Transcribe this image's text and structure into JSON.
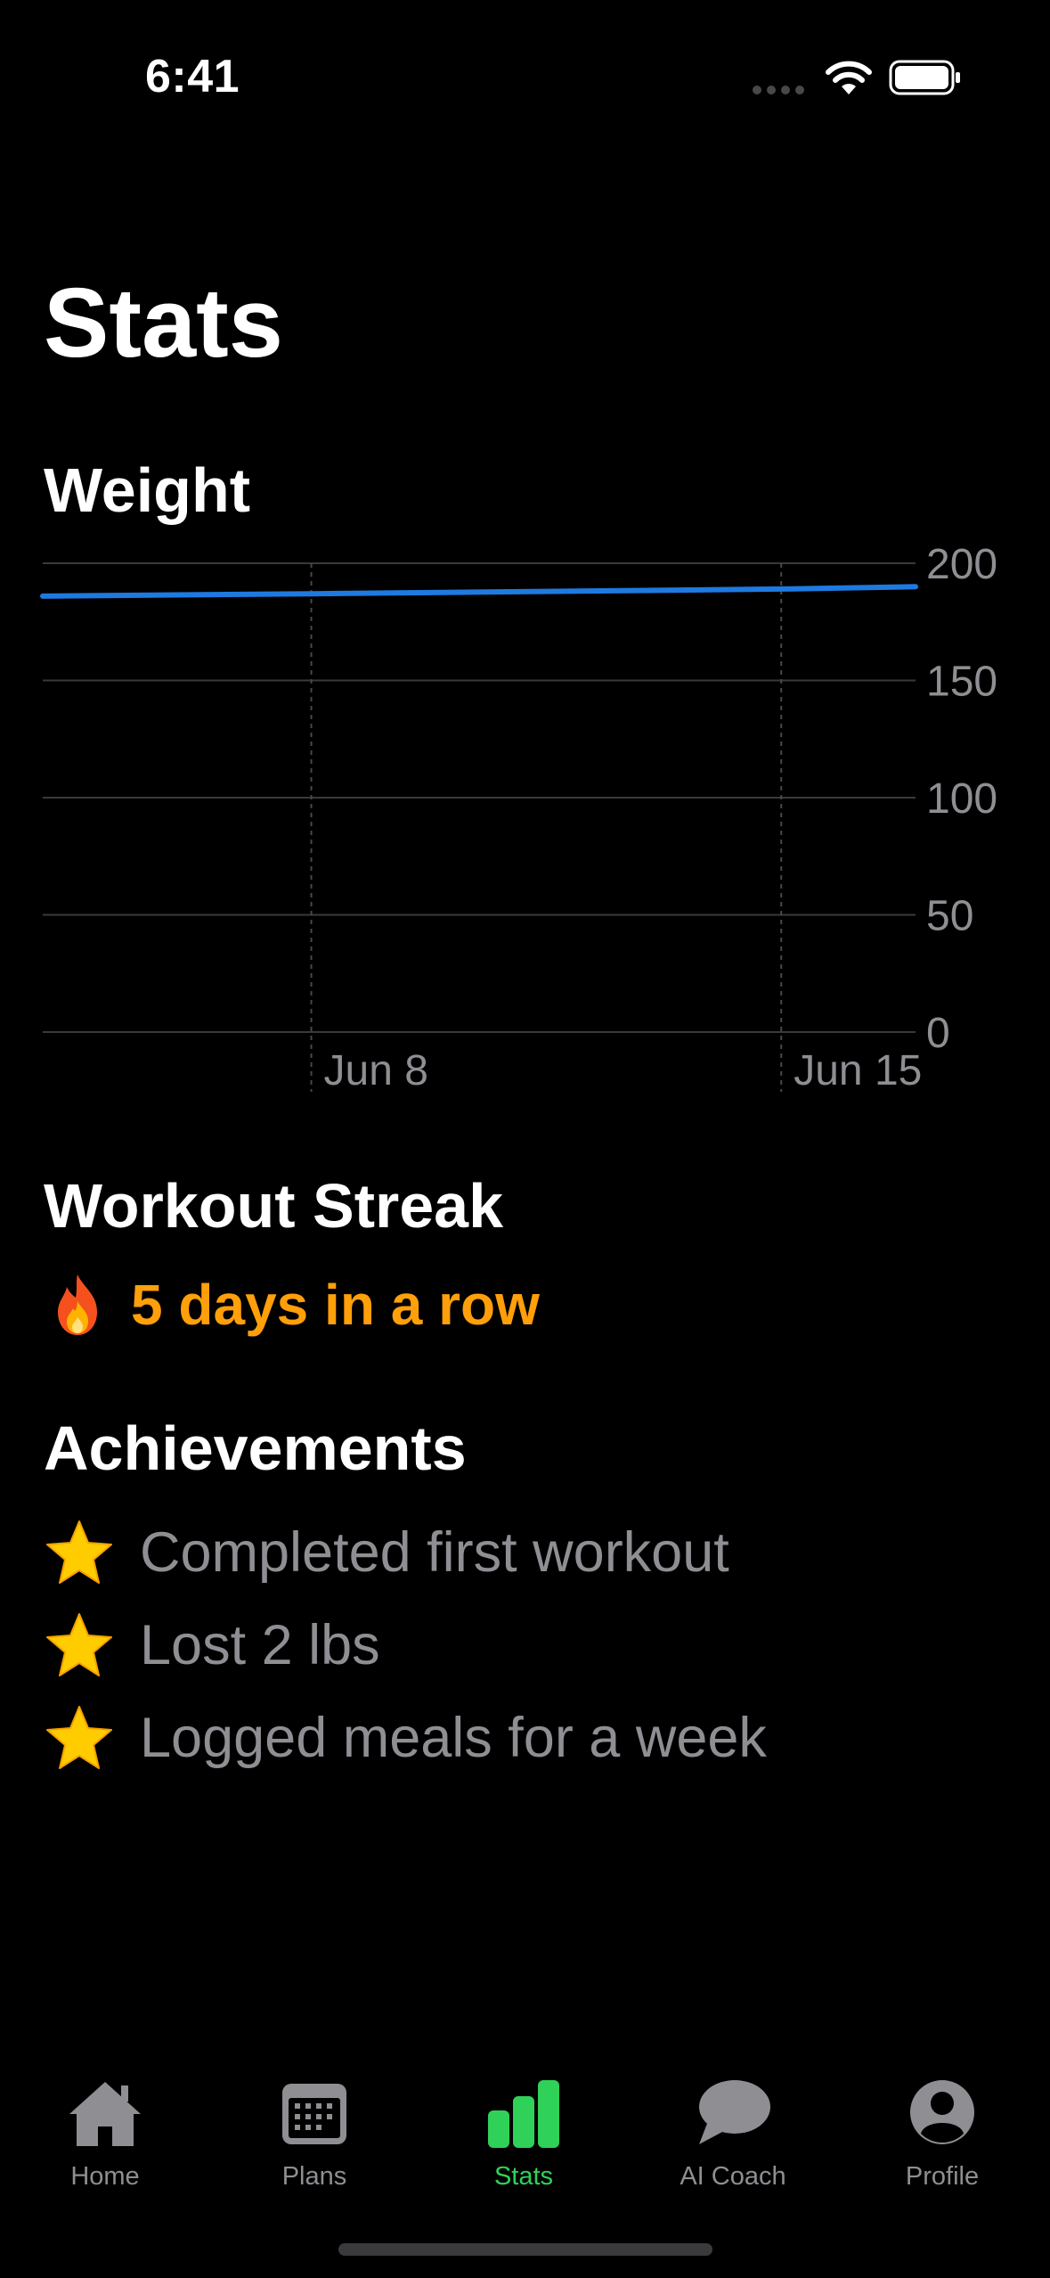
{
  "status_bar": {
    "time": "6:41"
  },
  "page_title": "Stats",
  "weight": {
    "title": "Weight",
    "chart_data": {
      "type": "line",
      "series": [
        {
          "x": [
            "Jun 4",
            "Jun 8",
            "Jun 15",
            "Jun 17"
          ],
          "values": [
            186,
            187,
            189,
            190
          ]
        }
      ],
      "x_ticks": [
        "Jun 8",
        "Jun 15"
      ],
      "y_ticks": [
        0,
        50,
        100,
        150,
        200
      ],
      "ylim": [
        0,
        200
      ],
      "grid": true,
      "line_color": "#1e7ae0"
    }
  },
  "streak": {
    "title": "Workout Streak",
    "text": "5 days in a row",
    "icon": "fire-icon",
    "color": "#ff9f0a"
  },
  "achievements": {
    "title": "Achievements",
    "items": [
      {
        "label": "Completed first workout",
        "icon": "star-icon"
      },
      {
        "label": "Lost 2 lbs",
        "icon": "star-icon"
      },
      {
        "label": "Logged meals for a week",
        "icon": "star-icon"
      }
    ]
  },
  "tabs": [
    {
      "label": "Home",
      "icon": "house-icon",
      "active": false
    },
    {
      "label": "Plans",
      "icon": "calendar-icon",
      "active": false
    },
    {
      "label": "Stats",
      "icon": "bar-chart-icon",
      "active": true
    },
    {
      "label": "AI Coach",
      "icon": "chat-bubble-icon",
      "active": false
    },
    {
      "label": "Profile",
      "icon": "person-circle-icon",
      "active": false
    }
  ],
  "colors": {
    "accent": "#30d158",
    "inactive": "#8e8e93",
    "streak": "#ff9f0a"
  }
}
